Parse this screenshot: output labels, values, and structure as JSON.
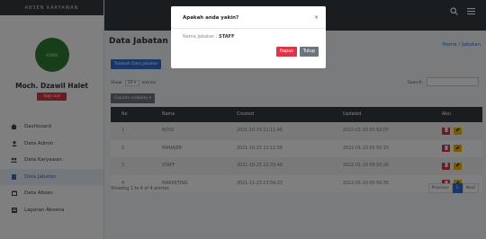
{
  "brand": "ABSEN KARYAWAN",
  "profile": {
    "avatar_text": "ADMIN",
    "name": "Moch. Dzawil Halet",
    "signout": "Sign out"
  },
  "menu": [
    {
      "label": "Dashboard",
      "icon": "home-icon"
    },
    {
      "label": "Data Admin",
      "icon": "user-icon"
    },
    {
      "label": "Data Karyawan",
      "icon": "users-icon"
    },
    {
      "label": "Data Jabatan",
      "icon": "file-icon"
    },
    {
      "label": "Data Absen",
      "icon": "calendar-icon"
    },
    {
      "label": "Laporan Absena",
      "icon": "report-icon"
    }
  ],
  "page": {
    "title": "Data Jabatan",
    "breadcrumb": "Home / Jabatan",
    "add_button": "Tambah Data Jabatan"
  },
  "table_controls": {
    "show": "Show",
    "entries_value": "10",
    "entries_suffix": "entries",
    "column_visibility": "Column visibility",
    "search_label": "Search:"
  },
  "table": {
    "headers": [
      "No",
      "Nama",
      "Created",
      "Updated",
      "Aksi"
    ],
    "rows": [
      {
        "no": "1",
        "nama": "BOSS",
        "created": "2021-10-25 21:11:46",
        "updated": "2022-01-10 05:50:07"
      },
      {
        "no": "2",
        "nama": "MANAJER",
        "created": "2021-10-25 21:11:59",
        "updated": "2022-01-10 05:50:15"
      },
      {
        "no": "3",
        "nama": "STAFF",
        "created": "2021-10-25 22:33:40",
        "updated": "2022-01-10 05:50:26"
      },
      {
        "no": "4",
        "nama": "MARKETING",
        "created": "2021-11-23 23:59:23",
        "updated": "2022-01-10 05:50:35"
      }
    ]
  },
  "table_info": "Showing 1 to 4 of 4 entries",
  "pagination": {
    "prev": "Previous",
    "current": "1",
    "next": "Next"
  },
  "modal": {
    "title": "Apakah anda yakin?",
    "close_glyph": "×",
    "body_label": "Nama Jabatan :",
    "body_value": "STAFF",
    "delete_button": "Hapus",
    "close_button": "Tutup"
  }
}
